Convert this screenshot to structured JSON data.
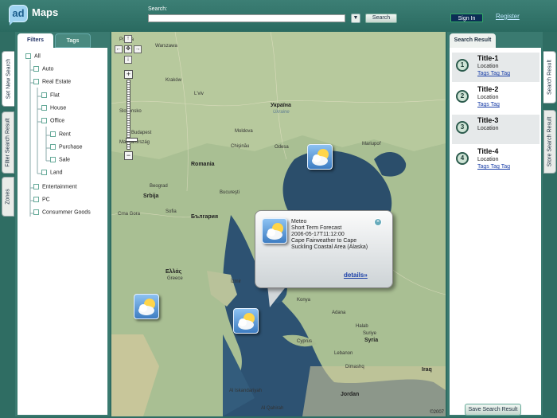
{
  "header": {
    "logo_text": "ad",
    "brand": "Maps",
    "search_label": "Search:",
    "search_value": "",
    "search_button": "Search",
    "signin_button": "Sign In",
    "register_link": "Register"
  },
  "left_tabs": [
    "Set New Search",
    "Filter Search Result",
    "Zones"
  ],
  "filter_tabs": {
    "filters": "Filters",
    "tags": "Tags"
  },
  "tree": [
    "All",
    "Auto",
    "Real Estate",
    "Flat",
    "House",
    "Office",
    "Rent",
    "Purchase",
    "Sale",
    "Land",
    "Entertainment",
    "PC",
    "Consummer Goods"
  ],
  "map": {
    "labels": {
      "warszawa": "Warszawa",
      "krakow": "Kraków",
      "lviv": "L'viv",
      "ukraina": "Україна",
      "ukraine": "Ukraine",
      "slovensko": "Slovensko",
      "budapest": "Budapest",
      "magyar": "Magyarország",
      "moldova": "Moldova",
      "chisinau": "Chişinău",
      "odesa": "Odesa",
      "romania": "Romania",
      "beograd": "Beograd",
      "srbija": "Srbija",
      "bucuresti": "Bucureşti",
      "crna_gora": "Crna Gora",
      "sofia": "Sofia",
      "bulgaria": "България",
      "ellas": "Ελλάς",
      "greece": "Greece",
      "izmir": "İzmir",
      "konya": "Konya",
      "adana": "Adana",
      "halab": "Halab",
      "suriye": "Suriye",
      "syria": "Syria",
      "cyprus": "Cyprus",
      "lebanon": "Lebanon",
      "dimashq": "Dimashq",
      "iraq": "Iraq",
      "mariupol": "Mariupol'",
      "jordan": "Jordan",
      "alex": "Al Iskandariyah",
      "cairo": "Al Qahirah",
      "polska": "Polska"
    },
    "copyright": "©2007",
    "popup": {
      "line1": "Meteo",
      "line2": "Short Term Forecast",
      "line3": "2006-05-17T11:12:00",
      "line4": "Cape Fairweather to Cape",
      "line5": "Suckling Coastal Area (Alaska)",
      "details": "details",
      "details_arrow": "»"
    }
  },
  "search_result": {
    "tab": "Search Result",
    "items": [
      {
        "num": "1",
        "title": "Title-1",
        "location": "Location",
        "tags": "Tags Tag Tag"
      },
      {
        "num": "2",
        "title": "Title-2",
        "location": "Location",
        "tags": "Tags Tag"
      },
      {
        "num": "3",
        "title": "Title-3",
        "location": "Location",
        "tags": ""
      },
      {
        "num": "4",
        "title": "Title-4",
        "location": "Location",
        "tags": "Tags Tag Tag"
      }
    ],
    "save_button": "Save Search Result"
  },
  "right_tabs": [
    "Search Result",
    "Store Search Result"
  ]
}
